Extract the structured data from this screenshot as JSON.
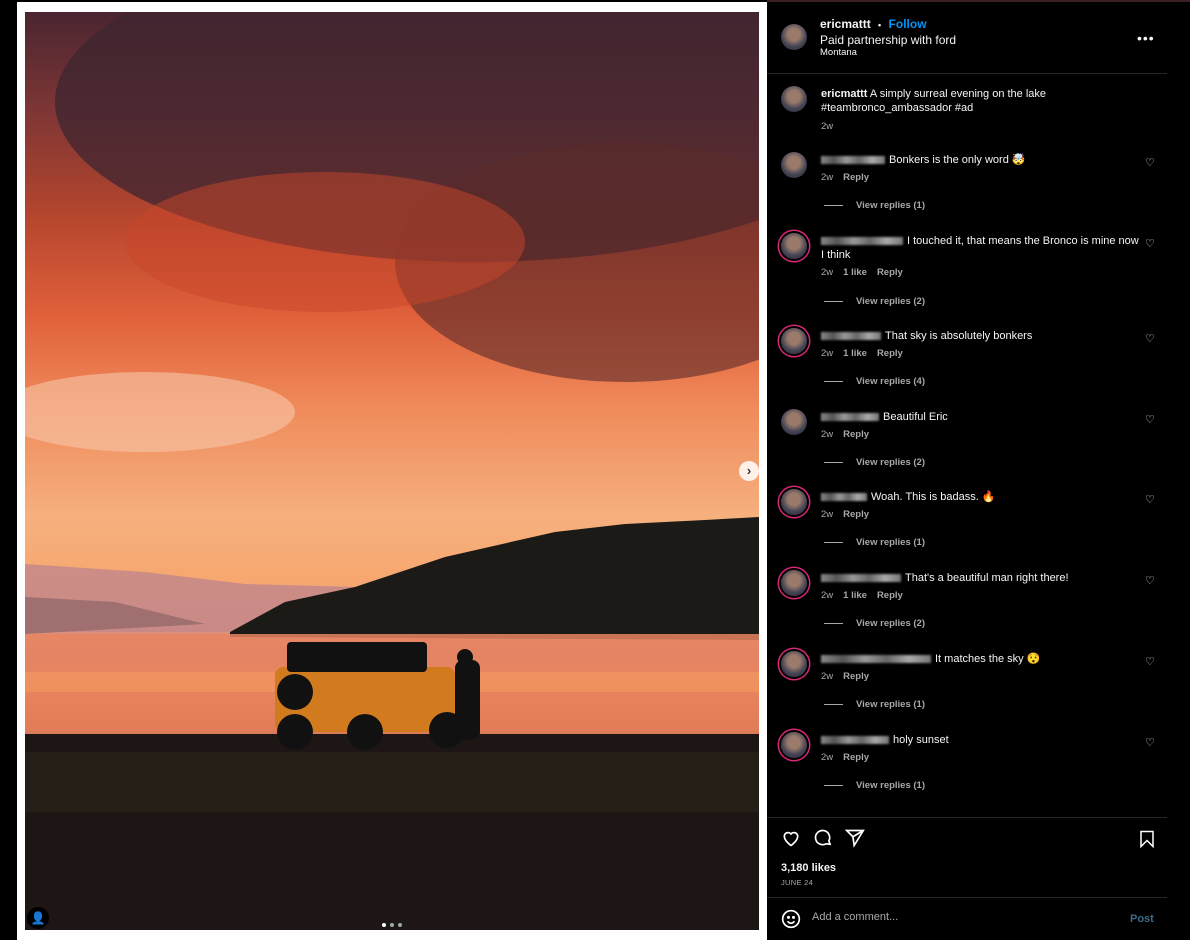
{
  "post": {
    "username": "ericmattt",
    "follow_label": "Follow",
    "separator": "•",
    "partnership": "Paid partnership with ford",
    "location": "Montana",
    "more_icon": "more-horizontal-icon",
    "caption_user": "ericmattt",
    "caption_text": "A simply surreal evening on the lake #teambronco_ambassador #ad",
    "caption_time": "2w",
    "likes": "3,180 likes",
    "date": "JUNE 24",
    "comment_placeholder": "Add a comment...",
    "post_label": "Post",
    "carousel": {
      "total": 3,
      "current": 1
    }
  },
  "comments": [
    {
      "text": "Bonkers is the only word 🤯",
      "time": "2w",
      "likes": "",
      "reply": "Reply",
      "view_replies": "View replies (1)"
    },
    {
      "text": "I touched it, that means the Bronco is mine now I think",
      "time": "2w",
      "likes": "1 like",
      "reply": "Reply",
      "view_replies": "View replies (2)"
    },
    {
      "text": "That sky is absolutely bonkers",
      "time": "2w",
      "likes": "1 like",
      "reply": "Reply",
      "view_replies": "View replies (4)"
    },
    {
      "text": "Beautiful Eric",
      "time": "2w",
      "likes": "",
      "reply": "Reply",
      "view_replies": "View replies (2)"
    },
    {
      "text": "Woah. This is badass. 🔥",
      "time": "2w",
      "likes": "",
      "reply": "Reply",
      "view_replies": "View replies (1)"
    },
    {
      "text": "That's a beautiful man right there!",
      "time": "2w",
      "likes": "1 like",
      "reply": "Reply",
      "view_replies": "View replies (2)"
    },
    {
      "text": "It matches the sky 😯",
      "time": "2w",
      "likes": "",
      "reply": "Reply",
      "view_replies": "View replies (1)"
    },
    {
      "text": "holy sunset",
      "time": "2w",
      "likes": "",
      "reply": "Reply",
      "view_replies": "View replies (1)"
    }
  ],
  "colors": {
    "accent": "#0095f6",
    "background": "#000000",
    "muted": "#a8a8a8"
  }
}
